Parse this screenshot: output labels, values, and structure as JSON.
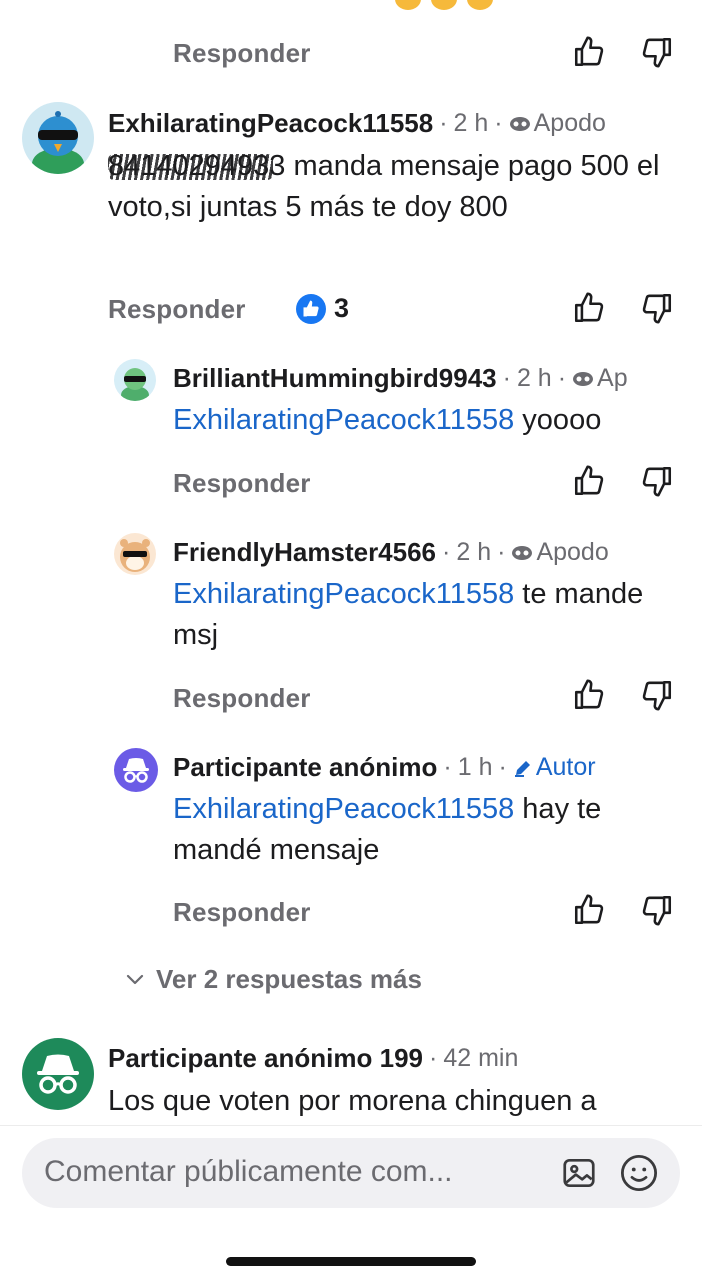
{
  "top_comment": {
    "reply_label": "Responder"
  },
  "comment1": {
    "author": "ExhilaratingPeacock11558",
    "time": "2 h",
    "badge": "Apodo",
    "body_hidden_prefix": "8414029493",
    "body": "3 manda mensaje pago 500  el voto,si juntas 5 más te doy 800",
    "reply_label": "Responder",
    "reaction_count": "3"
  },
  "reply1": {
    "author": "BrilliantHummingbird9943",
    "time": "2 h",
    "badge": "Ap",
    "mention": "ExhilaratingPeacock11558",
    "body": " yoooo",
    "reply_label": "Responder"
  },
  "reply2": {
    "author": "FriendlyHamster4566",
    "time": "2 h",
    "badge": "Apodo",
    "mention": "ExhilaratingPeacock11558",
    "body": " te mande msj",
    "reply_label": "Responder"
  },
  "reply3": {
    "author": "Participante anónimo",
    "time": "1 h",
    "badge": "Autor",
    "mention": "ExhilaratingPeacock11558",
    "body": " hay te mandé mensaje",
    "reply_label": "Responder"
  },
  "more_replies": {
    "label": "Ver 2 respuestas más"
  },
  "comment2": {
    "author": "Participante anónimo 199",
    "time": "42 min",
    "body": "Los que voten por morena chinguen a"
  },
  "composer": {
    "placeholder": "Comentar públicamente com..."
  },
  "colors": {
    "mention": "#1a66c9",
    "like_badge": "#1877f2",
    "anon_purple": "#6b5be6",
    "anon_green": "#1e8a5a"
  },
  "icons": {
    "like": "thumb-up-icon",
    "dislike": "thumb-down-icon",
    "badge_mask": "mask-icon",
    "badge_author": "pencil-icon",
    "image": "image-icon",
    "emoji": "emoji-icon",
    "expand": "chevron-down-icon"
  }
}
